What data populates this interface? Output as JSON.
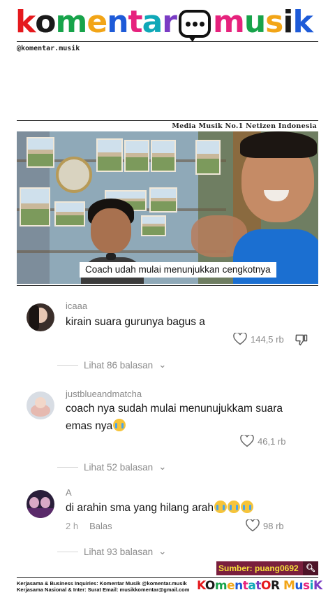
{
  "brand": {
    "logo_parts": [
      {
        "text": "k",
        "color": "#e5191d"
      },
      {
        "text": "o",
        "color": "#1a1a1a"
      },
      {
        "text": "m",
        "color": "#17a34a"
      },
      {
        "text": "e",
        "color": "#f2a517"
      },
      {
        "text": "n",
        "color": "#1e5bd8"
      },
      {
        "text": "t",
        "color": "#e6227d"
      },
      {
        "text": "a",
        "color": "#0fa8b8"
      },
      {
        "text": "r",
        "color": "#7a3cc4"
      }
    ],
    "logo_parts_2": [
      {
        "text": "m",
        "color": "#e6227d"
      },
      {
        "text": "u",
        "color": "#17a34a"
      },
      {
        "text": "s",
        "color": "#f2a517"
      },
      {
        "text": "i",
        "color": "#1a1a1a"
      },
      {
        "text": "k",
        "color": "#1e5bd8"
      }
    ],
    "logo_text": "komentar musik",
    "handle": "@komentar.musik",
    "tagline": "Media Musik No.1 Netizen Indonesia"
  },
  "video": {
    "caption": "Coach udah mulai menunjukkan cengkotnya"
  },
  "comments": [
    {
      "username": "icaaa",
      "text": "kirain suara gurunya bagus a",
      "emoji": "",
      "likes": "144,5 rb",
      "replies": "Lihat 86 balasan",
      "time": "",
      "reply_label": ""
    },
    {
      "username": "justblueandmatcha",
      "text": "coach nya sudah mulai menunujukkam suara emas nya",
      "emoji": "loudly-crying-face",
      "likes": "46,1 rb",
      "replies": "Lihat 52 balasan",
      "time": "",
      "reply_label": ""
    },
    {
      "username": "A",
      "text": "di arahin sma yang hilang arah",
      "emoji": "loudly-crying-face x3",
      "likes": "98 rb",
      "replies": "Lihat 93 balasan",
      "time": "2 h",
      "reply_label": "Balas"
    }
  ],
  "source": {
    "label": "Sumber: puang0692",
    "icon": "search-icon"
  },
  "footer": {
    "line1": "Kerjasama & Business Inquiries: Komentar Musik @komentar.musik",
    "line2": "Kerjasama Nasional & Inter: Surat Email: musikkomentar@gmail.com",
    "mini_logo": "KOmentatOR MusiK"
  },
  "colors": {
    "text_muted": "#8a8a8a",
    "source_bg": "#7a1f3d",
    "source_text": "#f6e13b",
    "shirt_blue": "#1b6fd1"
  }
}
